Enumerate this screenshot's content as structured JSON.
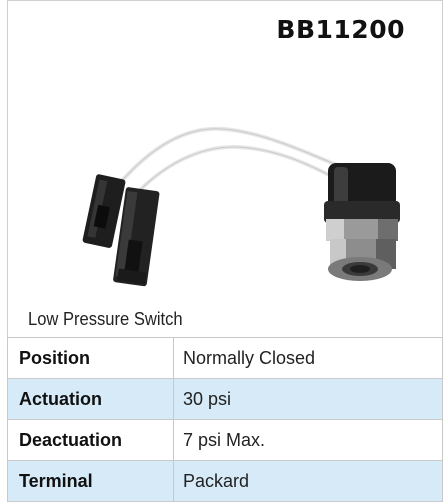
{
  "part_number": "BB11200",
  "caption": "Low Pressure Switch",
  "specs": [
    {
      "label": "Position",
      "value": "Normally Closed"
    },
    {
      "label": "Actuation",
      "value": "30 psi"
    },
    {
      "label": "Deactuation",
      "value": "7 psi Max."
    },
    {
      "label": "Terminal",
      "value": "Packard"
    }
  ],
  "colors": {
    "alt_row": "#d6eaf7",
    "border": "#c9c9c9"
  }
}
